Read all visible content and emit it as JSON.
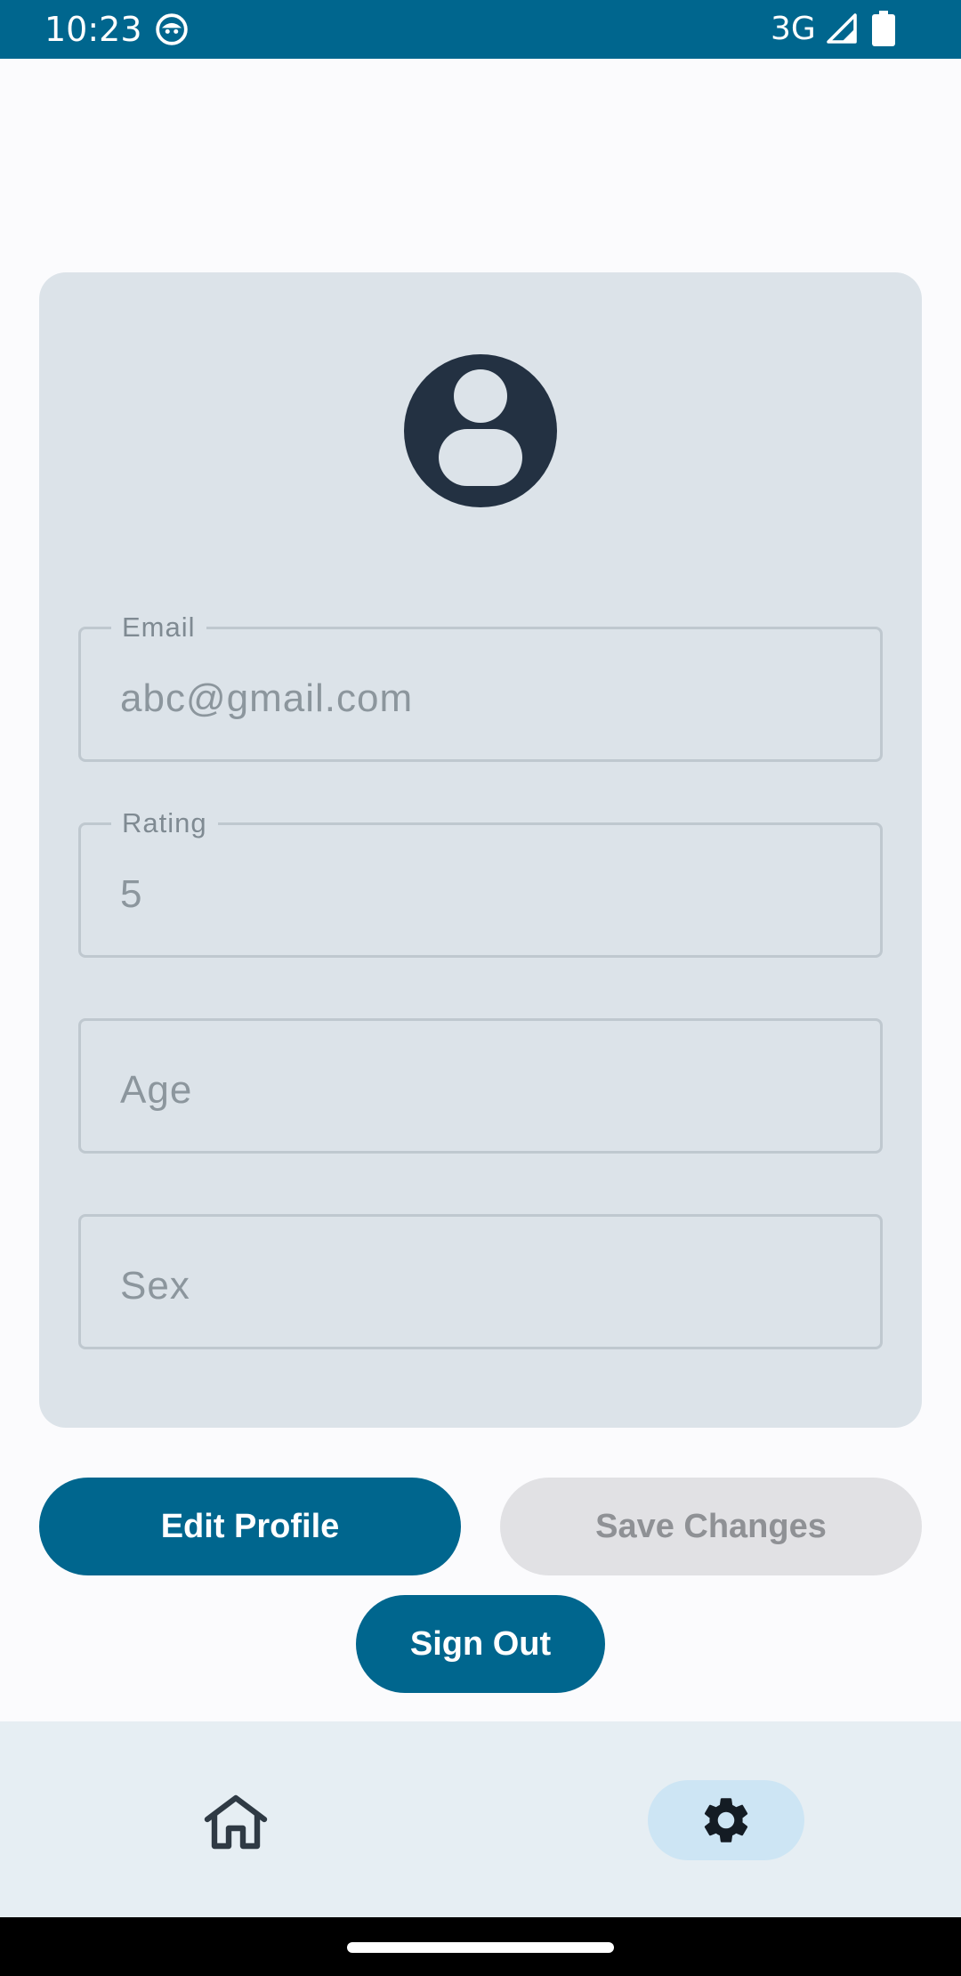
{
  "status_bar": {
    "time": "10:23",
    "network": "3G",
    "icons": [
      "app-notification-icon",
      "signal-icon",
      "battery-icon"
    ]
  },
  "profile": {
    "avatar_icon": "account-circle-icon",
    "fields": {
      "email": {
        "label": "Email",
        "value": "abc@gmail.com"
      },
      "rating": {
        "label": "Rating",
        "value": "5"
      },
      "age": {
        "placeholder": "Age"
      },
      "sex": {
        "placeholder": "Sex"
      }
    }
  },
  "actions": {
    "edit_profile": "Edit Profile",
    "save_changes": "Save Changes",
    "sign_out": "Sign Out"
  },
  "bottom_nav": {
    "items": [
      {
        "icon": "home-icon",
        "selected": false
      },
      {
        "icon": "settings-icon",
        "selected": true
      }
    ]
  },
  "colors": {
    "primary": "#00668e",
    "card_background": "#dce3e9",
    "disabled_button": "#e1e1e4",
    "nav_background": "#e6eef3",
    "nav_selected_pill": "#cde5f4"
  }
}
